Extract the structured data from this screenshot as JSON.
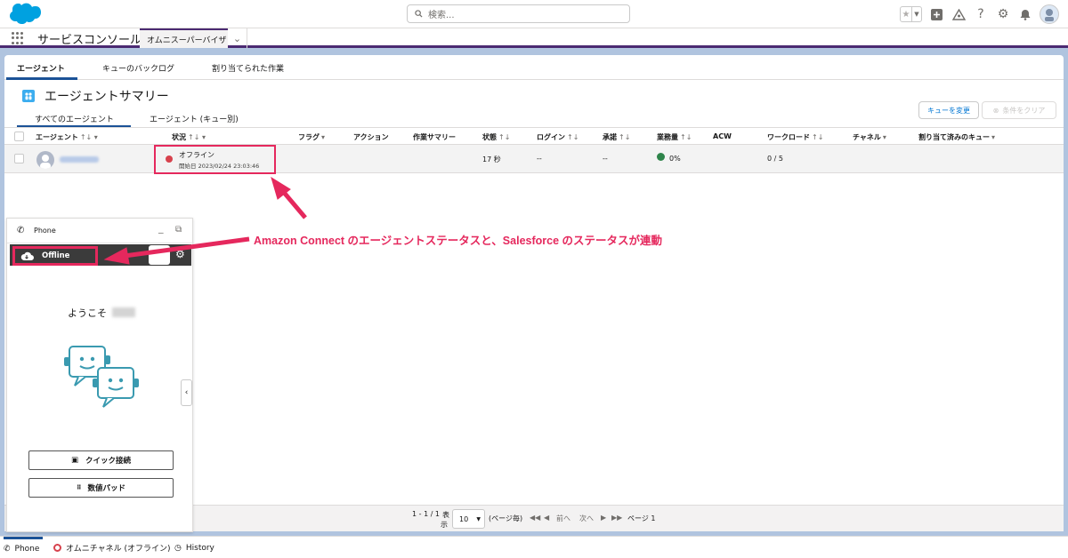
{
  "header": {
    "search_placeholder": "検索...",
    "app_name": "サービスコンソール",
    "nav_tab": "オムニスーパーバイザ"
  },
  "subtabs": [
    "エージェント",
    "キューのバックログ",
    "割り当てられた作業"
  ],
  "summary": {
    "title": "エージェントサマリー",
    "inner_tabs": [
      "すべてのエージェント",
      "エージェント (キュー別)"
    ],
    "btn_queue": "キューを変更",
    "btn_clear": "条件をクリア"
  },
  "table": {
    "columns": [
      "エージェント",
      "状況",
      "フラグ",
      "アクション",
      "作業サマリー",
      "状態",
      "ログイン",
      "承諾",
      "業務量",
      "ACW",
      "ワークロード",
      "チャネル",
      "割り当て済みのキュー"
    ],
    "row": {
      "status": "オフライン",
      "since": "開始日  2023/02/24 23:03:46",
      "state": "17 秒",
      "login": "--",
      "accept": "--",
      "utilization": "0%",
      "workload": "0 / 5"
    }
  },
  "pager": {
    "range": "1 - 1 / 1",
    "display_label_1": "表",
    "display_label_2": "示",
    "page_size": "10",
    "per_page": "(ページ毎)",
    "prev": "前へ",
    "next": "次へ",
    "page": "ページ 1"
  },
  "phone": {
    "title": "Phone",
    "status": "Offline",
    "welcome": "ようこそ",
    "quick_connect": "クイック接続",
    "dial_pad": "数値パッド"
  },
  "utility_bar": {
    "phone": "Phone",
    "omni": "オムニチャネル (オフライン)",
    "history": "History"
  },
  "annotation": "Amazon Connect のエージェントステータスと、Salesforce のステータスが連動",
  "colors": {
    "brand_purple": "#4b2a72",
    "annotation_pink": "#e5285d",
    "link_blue": "#0176d3",
    "offline_red": "#d7424d",
    "active_green": "#2e844a"
  }
}
